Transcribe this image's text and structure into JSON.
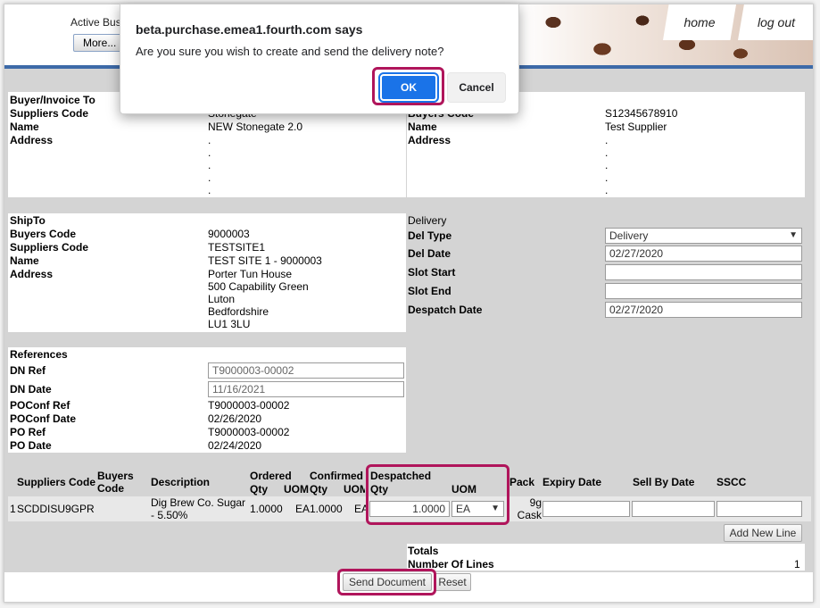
{
  "header": {
    "active_label": "Active Bus",
    "more_button": "More...",
    "nav_home": "home",
    "nav_logout": "log out"
  },
  "dialog": {
    "title": "beta.purchase.emea1.fourth.com says",
    "message": "Are you sure you wish to create and send the delivery note?",
    "ok": "OK",
    "cancel": "Cancel"
  },
  "buyer": {
    "section": "Buyer/Invoice To",
    "suppliers_code_label": "Suppliers Code",
    "suppliers_code": "Stonegate",
    "name_label": "Name",
    "name": "NEW Stonegate 2.0",
    "address_label": "Address",
    "address": [
      ".",
      ".",
      ".",
      ".",
      "."
    ]
  },
  "supplier": {
    "buyers_code_label": "Buyers Code",
    "buyers_code": "S12345678910",
    "name_label": "Name",
    "name": "Test Supplier",
    "address_label": "Address",
    "address": [
      ".",
      ".",
      ".",
      ".",
      "."
    ]
  },
  "shipto": {
    "section": "ShipTo",
    "buyers_code_label": "Buyers Code",
    "buyers_code": "9000003",
    "suppliers_code_label": "Suppliers Code",
    "suppliers_code": "TESTSITE1",
    "name_label": "Name",
    "name": "TEST SITE 1 - 9000003",
    "address_label": "Address",
    "address": [
      "Porter Tun House",
      "500 Capability Green",
      "Luton",
      "Bedfordshire",
      "LU1 3LU"
    ]
  },
  "delivery": {
    "section": "Delivery",
    "del_type_label": "Del Type",
    "del_type": "Delivery",
    "del_date_label": "Del Date",
    "del_date": "02/27/2020",
    "slot_start_label": "Slot Start",
    "slot_start": "",
    "slot_end_label": "Slot End",
    "slot_end": "",
    "despatch_date_label": "Despatch Date",
    "despatch_date": "02/27/2020"
  },
  "references": {
    "section": "References",
    "dn_ref_label": "DN Ref",
    "dn_ref": "T9000003-00002",
    "dn_date_label": "DN Date",
    "dn_date": "11/16/2021",
    "poconf_ref_label": "POConf Ref",
    "poconf_ref": "T9000003-00002",
    "poconf_date_label": "POConf Date",
    "poconf_date": "02/26/2020",
    "po_ref_label": "PO Ref",
    "po_ref": "T9000003-00002",
    "po_date_label": "PO Date",
    "po_date": "02/24/2020"
  },
  "lines": {
    "headers": {
      "suppliers_code": "Suppliers Code",
      "buyers_code": "Buyers Code",
      "description": "Description",
      "ordered": "Ordered",
      "confirmed": "Confirmed",
      "despatched": "Despatched",
      "qty": "Qty",
      "uom": "UOM",
      "pack": "Pack",
      "expiry_date": "Expiry Date",
      "sell_by_date": "Sell By Date",
      "sscc": "SSCC"
    },
    "rows": [
      {
        "index": "1",
        "suppliers_code": "SCDDISU9GPR",
        "buyers_code": "",
        "description": "Dig Brew Co. Sugar - 5.50%",
        "ordered_qty": "1.0000",
        "ordered_uom": "EA",
        "confirmed_qty": "1.0000",
        "confirmed_uom": "EA",
        "despatched_qty": "1.0000",
        "despatched_uom": "EA",
        "pack": "9g Cask",
        "expiry_date": "",
        "sell_by_date": "",
        "sscc": ""
      }
    ]
  },
  "add_new_line": "Add New Line",
  "totals": {
    "section": "Totals",
    "lines_label": "Number Of Lines",
    "lines_value": "1"
  },
  "footer": {
    "send": "Send Document",
    "reset": "Reset"
  },
  "colors": {
    "highlight": "#b0155b",
    "ok_button": "#1a73e8",
    "nav_bar": "#3d6aa8"
  }
}
